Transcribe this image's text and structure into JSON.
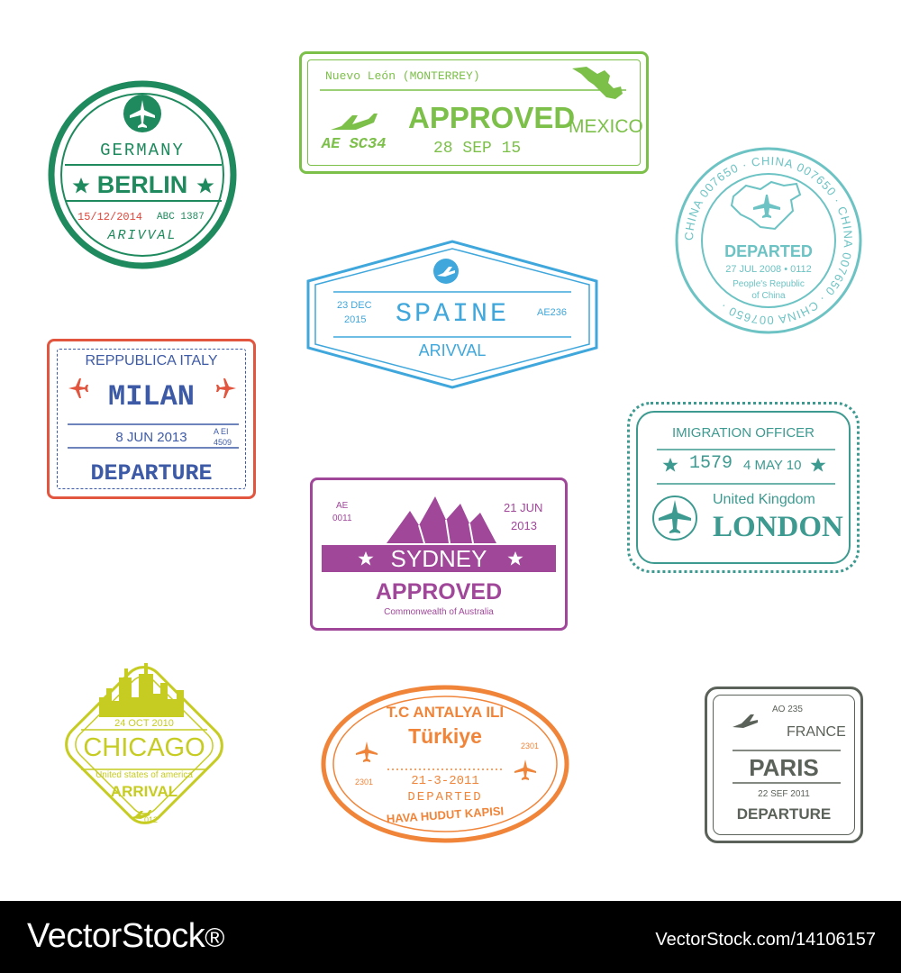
{
  "colors": {
    "germany": "#1f8a5e",
    "germany_date": "#e0463a",
    "mexico": "#7cc04a",
    "china": "#6dc3c4",
    "spain": "#3fa7dc",
    "italy_border": "#e2553e",
    "italy_text": "#3d5aa6",
    "italy_plane": "#e2553e",
    "sydney": "#a0479a",
    "london": "#3d9a90",
    "chicago": "#c6cc22",
    "turkey": "#f0853a",
    "paris": "#5b6259",
    "footer_bg": "#000000",
    "footer_text": "#ffffff"
  },
  "germany": {
    "country": "GERMANY",
    "city": "BERLIN",
    "date": "15/12/2014",
    "code": "ABC 1387",
    "type": "ARIVVAL",
    "icons": [
      "plane-icon",
      "star-icon"
    ]
  },
  "mexico": {
    "region": "Nuevo León (MONTERREY)",
    "status": "APPROVED",
    "country": "MEXICO",
    "flight": "AE SC34",
    "date": "28 SEP 15",
    "icons": [
      "plane-icon",
      "map-icon"
    ]
  },
  "china": {
    "ring_text": "CHINA 007650 · CHINA 007650 · CHINA 007650 · CHINA 007650 · ",
    "status": "DEPARTED",
    "date": "27 JUL 2008 • 0112",
    "country_line1": "People's Republic",
    "country_line2": "of China"
  },
  "spain": {
    "date_line1": "23 DEC",
    "date_line2": "2015",
    "city": "SPAINE",
    "code": "AE236",
    "type": "ARIVVAL"
  },
  "italy": {
    "country": "REPPUBLICA ITALY",
    "city": "MILAN",
    "date": "8 JUN 2013",
    "code_line1": "A EI",
    "code_line2": "4509",
    "type": "DEPARTURE"
  },
  "sydney": {
    "code_line1": "AE",
    "code_line2": "0011",
    "date_line1": "21 JUN",
    "date_line2": "2013",
    "city": "SYDNEY",
    "status": "APPROVED",
    "country": "Commonwealth of Australia"
  },
  "london": {
    "header": "IMIGRATION OFFICER",
    "number": "1579",
    "date": "4 MAY 10",
    "country": "United Kingdom",
    "city": "LONDON"
  },
  "chicago": {
    "date": "24 OCT 2010",
    "city": "CHICAGO",
    "country": "United states of america",
    "type": "ARRIVAL",
    "code": "012"
  },
  "turkey": {
    "region": "T.C ANTALYA ILI",
    "country": "Türkiye",
    "code": "2301",
    "date": "21-3-2011",
    "status": "DEPARTED",
    "bottom": "HAVA HUDUT KAPISI"
  },
  "paris": {
    "code": "AO 235",
    "country": "FRANCE",
    "city": "PARIS",
    "date": "22 SEF 2011",
    "type": "DEPARTURE"
  },
  "footer": {
    "brand": "VectorStock",
    "reg": "®",
    "image_id": "VectorStock.com/14106157"
  }
}
